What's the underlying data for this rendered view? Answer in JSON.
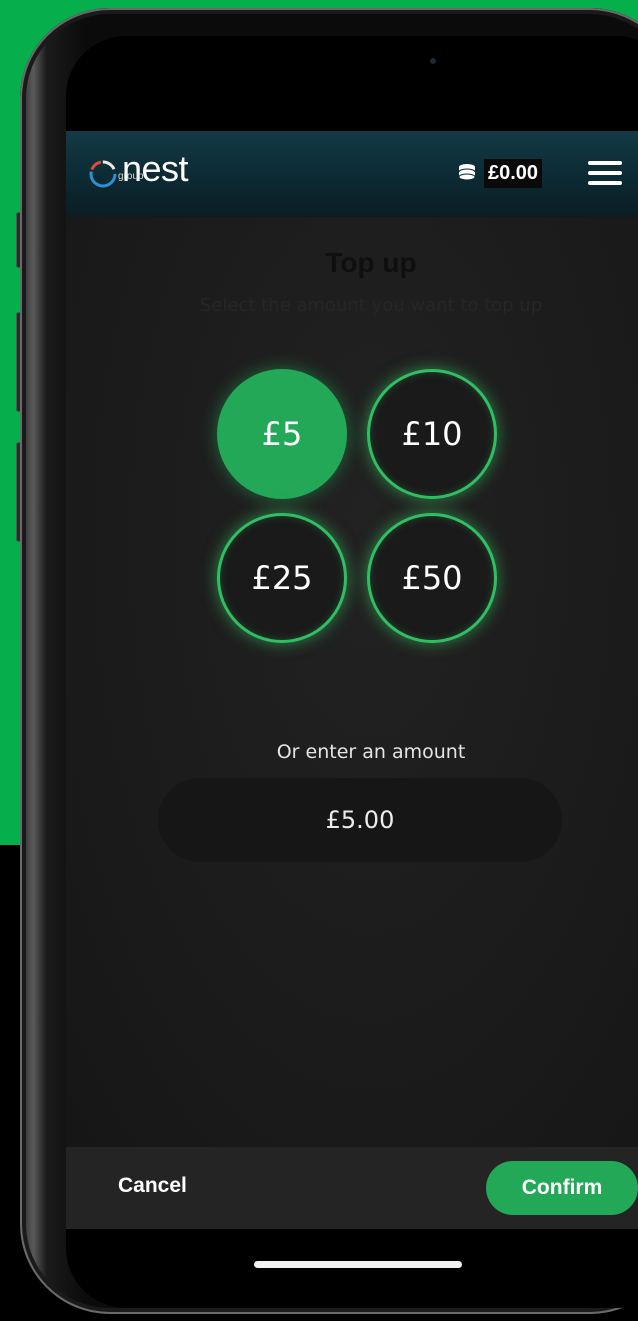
{
  "header": {
    "logo_word": "nest",
    "logo_sub": "group",
    "balance": "£0.00",
    "icons": {
      "logo": "nest-ring-logo",
      "balance": "coins-icon",
      "menu": "hamburger-menu-icon"
    }
  },
  "main": {
    "title": "Top up",
    "subtitle": "Select the amount you want to top up",
    "amounts": [
      {
        "label": "£5",
        "selected": true
      },
      {
        "label": "£10",
        "selected": false
      },
      {
        "label": "£25",
        "selected": false
      },
      {
        "label": "£50",
        "selected": false
      }
    ],
    "custom_label": "Or enter an amount",
    "custom_value": "£5.00"
  },
  "footer": {
    "cancel_label": "Cancel",
    "confirm_label": "Confirm"
  },
  "colors": {
    "brand_green": "#22a857",
    "page_green": "#05b04c",
    "header_teal": "#133a45"
  }
}
